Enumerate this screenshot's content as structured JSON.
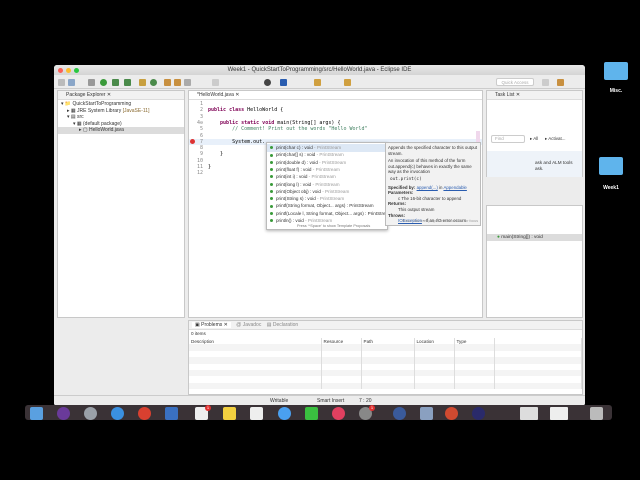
{
  "window": {
    "title": "Week1 - QuickStartToProgramming/src/HelloWorld.java - Eclipse IDE",
    "quick_access": "Quick Access"
  },
  "package_explorer": {
    "tab": "Package Explorer",
    "items": [
      "QuickStartToProgramming",
      "JRE System Library",
      "[JavaSE-11]",
      "src",
      "(default package)",
      "HelloWorld.java"
    ]
  },
  "editor": {
    "tab": "*HelloWorld.java",
    "line_numbers": [
      "1",
      "2",
      "3",
      "4⊖",
      "5",
      "6",
      "7",
      "8",
      "9",
      "10",
      "11",
      "12"
    ],
    "lines": {
      "l2a": "public class",
      "l2b": " HelloWorld {",
      "l4a": "    public static void",
      "l4b": " main(String[] args) {",
      "l5": "        // Comment! Print out the words \"Hello World\"",
      "l7": "        System.out.",
      "l9": "    }",
      "l11": "}"
    }
  },
  "autocomplete": {
    "items": [
      {
        "sig": "print(char c) : void",
        "type": " - PrintStream"
      },
      {
        "sig": "print(char[] s) : void",
        "type": " - PrintStream"
      },
      {
        "sig": "print(double d) : void",
        "type": " - PrintStream"
      },
      {
        "sig": "print(float f) : void",
        "type": " - PrintStream"
      },
      {
        "sig": "print(int i) : void",
        "type": " - PrintStream"
      },
      {
        "sig": "print(long l) : void",
        "type": " - PrintStream"
      },
      {
        "sig": "print(Object obj) : void",
        "type": " - PrintStream"
      },
      {
        "sig": "print(String s) : void",
        "type": " - PrintStream"
      },
      {
        "sig": "printf(String format, Object... args) : PrintStream",
        "type": ""
      },
      {
        "sig": "printf(Locale l, String format, Object... args) : PrintStream",
        "type": ""
      },
      {
        "sig": "println() : void",
        "type": " - PrintStream"
      }
    ],
    "footer": "Press '^Space' to show Template Proposals"
  },
  "javadoc": {
    "summary": "Appends the specified character to this output stream.",
    "invocation": "An invocation of this method of the form out.append(c) behaves in exactly the same way as the invocation",
    "code": "out.print(c)",
    "specified_label": "Specified by:",
    "specified_link": "append(...)",
    "specified_in": " in ",
    "specified_iface": "Appendable",
    "params_label": "Parameters:",
    "param": "c The 16-bit character to append",
    "returns_label": "Returns:",
    "returns": "This output stream",
    "throws_label": "Throws:",
    "throws_link": "IOException",
    "throws_text": " - If an I/O error occurs",
    "footer": "Press 'Tab' from proposal table or click for focus"
  },
  "task_list": {
    "tab": "Task List",
    "find_placeholder": "Find",
    "all": "All",
    "activate": "Activat...",
    "connect_text": "ask and ALM tools",
    "connect_text2": "ask."
  },
  "outline": {
    "item": "main(String[]) : void"
  },
  "problems": {
    "tabs": [
      "Problems",
      "Javadoc",
      "Declaration"
    ],
    "count": "0 items",
    "columns": [
      "Description",
      "Resource",
      "Path",
      "Location",
      "Type"
    ]
  },
  "status": {
    "writable": "Writable",
    "insert": "Smart Insert",
    "position": "7 : 20"
  },
  "dock": {
    "badges": [
      "1",
      "1"
    ]
  },
  "desktop": {
    "icons": [
      "Misc.",
      "Week1"
    ]
  }
}
